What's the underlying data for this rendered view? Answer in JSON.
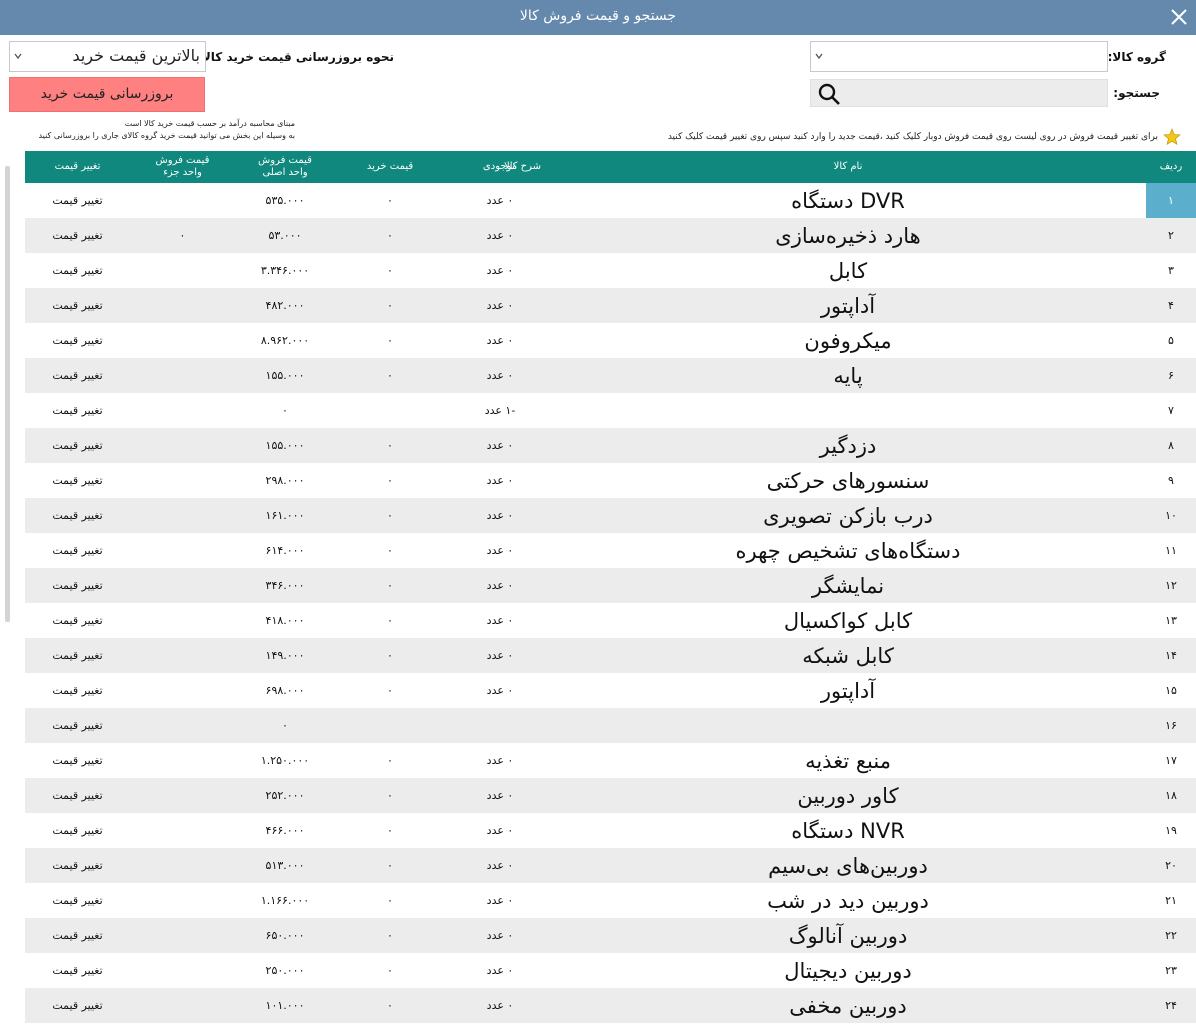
{
  "window": {
    "title": "جستجو و قیمت فروش کالا"
  },
  "filters": {
    "group_label": "گروه کالا:",
    "group_value": "",
    "search_label": "جستجو:",
    "search_value": "",
    "update_mode_label": "نحوه بروزرسانی قیمت خرید کالا :",
    "update_mode_value": "بالاترین قیمت خرید",
    "update_button": "بروزرسانی قیمت خرید",
    "note_line1": "مبنای محاسبه درآمد بر حسب قیمت خرید کالا است",
    "note_line2": "به وسیله این بخش می توانید قیمت خرید گروه کالای جاری را بروزرسانی کنید",
    "hint": "برای تغییر قیمت فروش در روی لیست روی قیمت فروش دوبار کلیک کنید ،قیمت جدید را وارد کنید سپس روی تغییر قیمت کلیک کنید"
  },
  "table": {
    "headers": {
      "row": "ردیف",
      "name": "نام کالا",
      "desc": "شرح کالا",
      "stock": "موجودی",
      "buy": "قیمت خرید",
      "sell_main_1": "قیمت فروش",
      "sell_main_2": "واحد اصلی",
      "sell_part_1": "قیمت فروش",
      "sell_part_2": "واحد جزء",
      "change": "تغییر قیمت"
    },
    "rows": [
      {
        "num": "۱",
        "name": "DVR دستگاه",
        "stock": "۰ عدد",
        "buy": "۰",
        "sell": "۵۳۵.۰۰۰",
        "part": "",
        "change": "تغییر قیمت"
      },
      {
        "num": "۲",
        "name": "هارد ذخیره‌سازی",
        "stock": "۰ عدد",
        "buy": "۰",
        "sell": "۵۳.۰۰۰",
        "part": "۰",
        "change": "تغییر قیمت"
      },
      {
        "num": "۳",
        "name": "کابل",
        "stock": "۰ عدد",
        "buy": "۰",
        "sell": "۳.۳۴۶.۰۰۰",
        "part": "",
        "change": "تغییر قیمت"
      },
      {
        "num": "۴",
        "name": "آداپتور",
        "stock": "۰ عدد",
        "buy": "۰",
        "sell": "۴۸۲.۰۰۰",
        "part": "",
        "change": "تغییر قیمت"
      },
      {
        "num": "۵",
        "name": "میکروفون",
        "stock": "۰ عدد",
        "buy": "۰",
        "sell": "۸.۹۶۲.۰۰۰",
        "part": "",
        "change": "تغییر قیمت"
      },
      {
        "num": "۶",
        "name": "پایه",
        "stock": "۰ عدد",
        "buy": "۰",
        "sell": "۱۵۵.۰۰۰",
        "part": "",
        "change": "تغییر قیمت"
      },
      {
        "num": "۷",
        "name": "",
        "stock": "-۱ عدد",
        "buy": "",
        "sell": "۰",
        "part": "",
        "change": "تغییر قیمت"
      },
      {
        "num": "۸",
        "name": "دزدگیر",
        "stock": "۰ عدد",
        "buy": "۰",
        "sell": "۱۵۵.۰۰۰",
        "part": "",
        "change": "تغییر قیمت"
      },
      {
        "num": "۹",
        "name": "سنسورهای حرکتی",
        "stock": "۰ عدد",
        "buy": "۰",
        "sell": "۲۹۸.۰۰۰",
        "part": "",
        "change": "تغییر قیمت"
      },
      {
        "num": "۱۰",
        "name": "درب بازکن تصویری",
        "stock": "۰ عدد",
        "buy": "۰",
        "sell": "۱۶۱.۰۰۰",
        "part": "",
        "change": "تغییر قیمت"
      },
      {
        "num": "۱۱",
        "name": "دستگاه‌های تشخیص چهره",
        "stock": "۰ عدد",
        "buy": "۰",
        "sell": "۶۱۴.۰۰۰",
        "part": "",
        "change": "تغییر قیمت"
      },
      {
        "num": "۱۲",
        "name": "نمایشگر",
        "stock": "۰ عدد",
        "buy": "۰",
        "sell": "۳۴۶.۰۰۰",
        "part": "",
        "change": "تغییر قیمت"
      },
      {
        "num": "۱۳",
        "name": "کابل کواکسیال",
        "stock": "۰ عدد",
        "buy": "۰",
        "sell": "۴۱۸.۰۰۰",
        "part": "",
        "change": "تغییر قیمت"
      },
      {
        "num": "۱۴",
        "name": "کابل شبکه",
        "stock": "۰ عدد",
        "buy": "۰",
        "sell": "۱۴۹.۰۰۰",
        "part": "",
        "change": "تغییر قیمت"
      },
      {
        "num": "۱۵",
        "name": "آداپتور",
        "stock": "۰ عدد",
        "buy": "۰",
        "sell": "۶۹۸.۰۰۰",
        "part": "",
        "change": "تغییر قیمت"
      },
      {
        "num": "۱۶",
        "name": "",
        "stock": "",
        "buy": "",
        "sell": "۰",
        "part": "",
        "change": "تغییر قیمت"
      },
      {
        "num": "۱۷",
        "name": "منبع تغذیه",
        "stock": "۰ عدد",
        "buy": "۰",
        "sell": "۱.۲۵۰.۰۰۰",
        "part": "",
        "change": "تغییر قیمت"
      },
      {
        "num": "۱۸",
        "name": "کاور دوربین",
        "stock": "۰ عدد",
        "buy": "۰",
        "sell": "۲۵۲.۰۰۰",
        "part": "",
        "change": "تغییر قیمت"
      },
      {
        "num": "۱۹",
        "name": "NVR دستگاه",
        "stock": "۰ عدد",
        "buy": "۰",
        "sell": "۴۶۶.۰۰۰",
        "part": "",
        "change": "تغییر قیمت"
      },
      {
        "num": "۲۰",
        "name": "دوربین‌های بی‌سیم",
        "stock": "۰ عدد",
        "buy": "۰",
        "sell": "۵۱۳.۰۰۰",
        "part": "",
        "change": "تغییر قیمت"
      },
      {
        "num": "۲۱",
        "name": "دوربین دید در شب",
        "stock": "۰ عدد",
        "buy": "۰",
        "sell": "۱.۱۶۶.۰۰۰",
        "part": "",
        "change": "تغییر قیمت"
      },
      {
        "num": "۲۲",
        "name": "دوربین آنالوگ",
        "stock": "۰ عدد",
        "buy": "۰",
        "sell": "۶۵۰.۰۰۰",
        "part": "",
        "change": "تغییر قیمت"
      },
      {
        "num": "۲۳",
        "name": "دوربین دیجیتال",
        "stock": "۰ عدد",
        "buy": "۰",
        "sell": "۲۵۰.۰۰۰",
        "part": "",
        "change": "تغییر قیمت"
      },
      {
        "num": "۲۴",
        "name": "دوربین مخفی",
        "stock": "۰ عدد",
        "buy": "۰",
        "sell": "۱۰۱.۰۰۰",
        "part": "",
        "change": "تغییر قیمت"
      }
    ]
  },
  "colors": {
    "titlebar": "#6489ad",
    "header": "#10887e",
    "selected_row": "#5bafcc",
    "update_button": "#ff8080",
    "row_alt": "#ececec"
  }
}
